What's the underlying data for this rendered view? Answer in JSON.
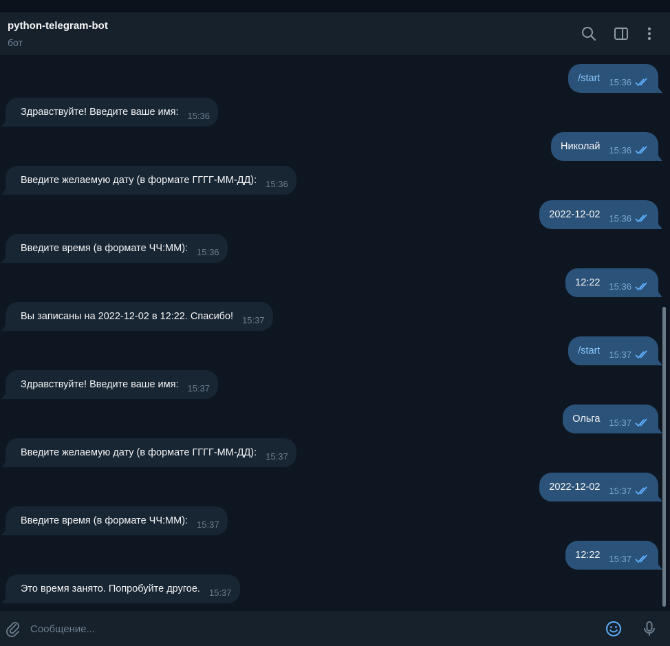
{
  "header": {
    "title": "python-telegram-bot",
    "subtitle": "бот"
  },
  "icons": {
    "search": "search-icon",
    "sidebar": "sidebar-panel-icon",
    "more": "more-vertical-icon",
    "attach": "paperclip-icon",
    "emoji": "emoji-icon",
    "mic": "microphone-icon",
    "read": "double-check-icon"
  },
  "colors": {
    "background": "#0e1621",
    "header": "#17212b",
    "incoming_bubble": "#182533",
    "outgoing_bubble": "#2b5278",
    "command_text": "#8ac8ff",
    "read_ticks": "#5fb0ff"
  },
  "messages": [
    {
      "dir": "out",
      "text": "/start",
      "time": "15:36",
      "command": true
    },
    {
      "dir": "in",
      "text": "Здравствуйте! Введите ваше имя:",
      "time": "15:36"
    },
    {
      "dir": "out",
      "text": "Николай",
      "time": "15:36"
    },
    {
      "dir": "in",
      "text": "Введите желаемую дату (в формате ГГГГ-ММ-ДД):",
      "time": "15:36"
    },
    {
      "dir": "out",
      "text": "2022-12-02",
      "time": "15:36"
    },
    {
      "dir": "in",
      "text": "Введите время (в формате ЧЧ:ММ):",
      "time": "15:36"
    },
    {
      "dir": "out",
      "text": "12:22",
      "time": "15:36"
    },
    {
      "dir": "in",
      "text": "Вы записаны на 2022-12-02 в 12:22. Спасибо!",
      "time": "15:37"
    },
    {
      "dir": "out",
      "text": "/start",
      "time": "15:37",
      "command": true
    },
    {
      "dir": "in",
      "text": "Здравствуйте! Введите ваше имя:",
      "time": "15:37"
    },
    {
      "dir": "out",
      "text": "Ольга",
      "time": "15:37"
    },
    {
      "dir": "in",
      "text": "Введите желаемую дату (в формате ГГГГ-ММ-ДД):",
      "time": "15:37"
    },
    {
      "dir": "out",
      "text": "2022-12-02",
      "time": "15:37"
    },
    {
      "dir": "in",
      "text": "Введите время (в формате ЧЧ:ММ):",
      "time": "15:37"
    },
    {
      "dir": "out",
      "text": "12:22",
      "time": "15:37"
    },
    {
      "dir": "in",
      "text": "Это время занято. Попробуйте другое.",
      "time": "15:37"
    }
  ],
  "composer": {
    "placeholder": "Сообщение..."
  }
}
